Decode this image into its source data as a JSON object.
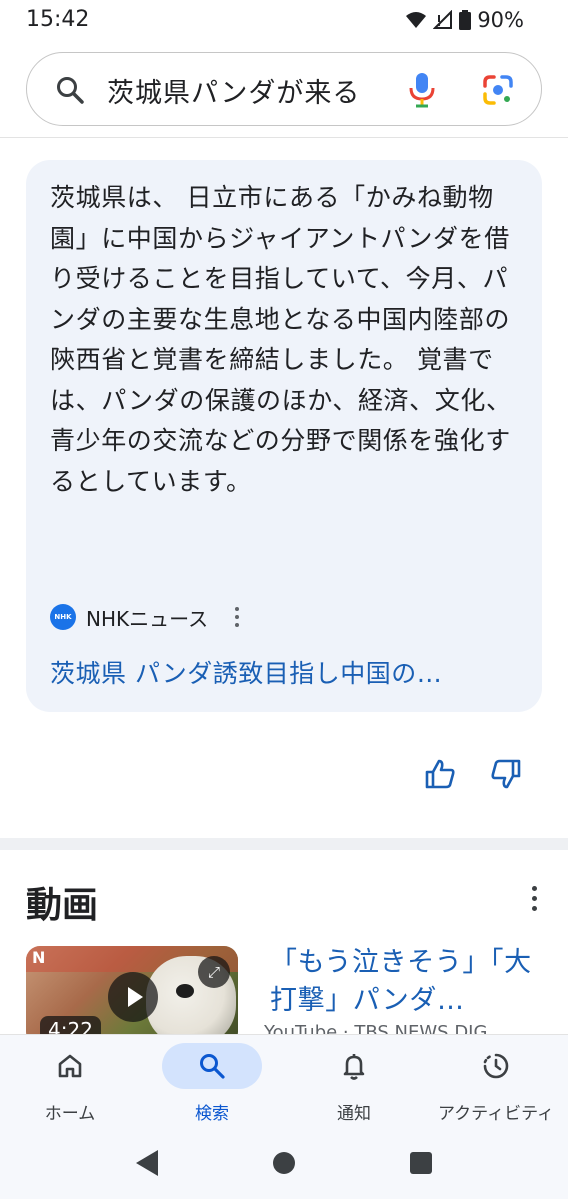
{
  "status_bar": {
    "time": "15:42",
    "battery": "90%",
    "icons": [
      "wifi-icon",
      "signal-icon",
      "battery-icon"
    ]
  },
  "search": {
    "query": "茨城県パンダが来る",
    "icons": [
      "search-icon",
      "mic-icon",
      "lens-icon"
    ]
  },
  "ai_overview": {
    "text": "茨城県は、 日立市にある「かみね動物園」に中国からジャイアントパンダを借り受けることを目指していて、今月、パンダの主要な生息地となる中国内陸部の陝西省と覚書を締結しました。 覚書では、パンダの保護のほか、経済、文化、青少年の交流などの分野で関係を強化するとしています。",
    "source_logo_text": "NHK",
    "source_name": "NHKニュース",
    "link_title": "茨城県 パンダ誘致目指し中国の…",
    "background_color": "#eff3fa",
    "link_color": "#1a5fb4"
  },
  "feedback": {
    "icons": [
      "thumbs-up-icon",
      "thumbs-down-icon"
    ]
  },
  "videos": {
    "heading": "動画",
    "items": [
      {
        "title": "「もう泣きそう」「大打撃」パンダ…",
        "source": "YouTube · TBS NEWS DIG",
        "duration": "4:22",
        "thumb_badge": "N"
      }
    ]
  },
  "bottom_nav": {
    "items": [
      {
        "label": "ホーム",
        "icon": "home-icon",
        "active": false
      },
      {
        "label": "検索",
        "icon": "search-icon",
        "active": true
      },
      {
        "label": "通知",
        "icon": "bell-icon",
        "active": false
      },
      {
        "label": "アクティビティ",
        "icon": "activity-icon",
        "active": false
      }
    ],
    "active_color": "#0b57d0"
  }
}
